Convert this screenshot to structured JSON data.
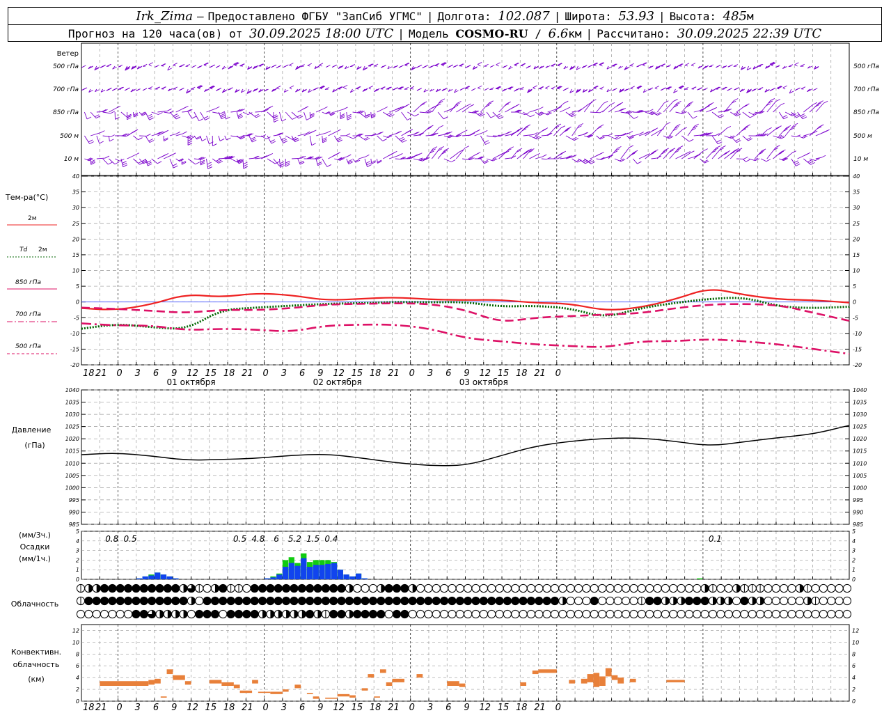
{
  "header": {
    "station": "Irk_Zima",
    "dash": "–",
    "provider": "Предоставлено ФГБУ \"ЗапСиб УГМС\"",
    "lon_label": "Долгота:",
    "lon_value": "102.087",
    "lat_label": "Широта:",
    "lat_value": "53.93",
    "alt_label": "Высота:",
    "alt_value": "485",
    "alt_unit": "м",
    "forecast_prefix": "Прогноз на 120 часа(ов) от",
    "forecast_time": "30.09.2025 18:00 UTC",
    "model_label": "Модель",
    "model_name": "COSMO-RU",
    "model_res": "6.6",
    "model_res_unit": "км",
    "calc_label": "Рассчитано:",
    "calc_time": "30.09.2025 22:39 UTC",
    "sep": "|"
  },
  "colors": {
    "t2m": "#ee2222",
    "td2m": "#006600",
    "t850": "#dd1166",
    "t700": "#dd1166",
    "t500": "#dd1166",
    "wind": "#7a00cc",
    "pressure": "#000000",
    "precip3h": "#11cc11",
    "precip1h": "#1144ee",
    "convective": "#e8803a",
    "grid": "#999999"
  },
  "chart_data": [
    {
      "type": "wind-barbs",
      "name": "wind",
      "title": "Ветер",
      "levels": [
        "500 гПа",
        "700 гПа",
        "850 гПа",
        "500 м",
        "10 м"
      ]
    },
    {
      "type": "line",
      "name": "temperature",
      "ylabel": "Тем-ра(°C)",
      "ylim": [
        -20,
        40
      ],
      "yticks": [
        -20,
        -15,
        -10,
        -5,
        0,
        5,
        10,
        15,
        20,
        25,
        30,
        35,
        40
      ],
      "x_hours": [
        0,
        6,
        12,
        18,
        24,
        30,
        36,
        42,
        48,
        54,
        60,
        66,
        72,
        78,
        84,
        90,
        96,
        102,
        108,
        114,
        120
      ],
      "series": [
        {
          "name": "2м",
          "key": "t2m",
          "style": "solid",
          "values": [
            -2.0,
            -2.6,
            -0.8,
            2.5,
            1.5,
            2.8,
            2.2,
            0.5,
            1.0,
            1.5,
            0.8,
            0.6,
            0.7,
            -0.3,
            -0.5,
            -2.8,
            -1.8,
            0.8,
            4.5,
            2.2,
            0.8,
            0.6,
            -0.2
          ]
        },
        {
          "name": "Td 2м",
          "key": "td2m",
          "style": "dot",
          "values": [
            -8.5,
            -7.0,
            -8.0,
            -8.8,
            -2.5,
            -1.8,
            -1.2,
            -0.6,
            -0.4,
            0.0,
            -0.1,
            0.0,
            -1.5,
            -1.2,
            -2.0,
            -5.0,
            -2.0,
            -0.3,
            1.0,
            1.5,
            -1.5,
            -2.0,
            -1.5
          ]
        },
        {
          "name": "850 гПа",
          "key": "t850",
          "style": "dash",
          "values": [
            -1.8,
            -2.2,
            -2.8,
            -3.5,
            -2.5,
            -2.6,
            -2.0,
            -0.8,
            -0.6,
            -0.4,
            -0.6,
            -2.5,
            -6.5,
            -5.0,
            -4.5,
            -4.0,
            -3.6,
            -2.0,
            -0.8,
            -0.6,
            -1.0,
            -3.5,
            -6.0
          ]
        },
        {
          "name": "700 гПа",
          "key": "t700",
          "style": "dashdot",
          "values": [
            -6.8,
            -7.5,
            -7.5,
            -9.0,
            -8.5,
            -8.8,
            -9.5,
            -7.5,
            -7.2,
            -7.2,
            -8.5,
            -11.5,
            -12.5,
            -13.5,
            -14.0,
            -14.5,
            -12.5,
            -12.5,
            -11.8,
            -12.5,
            -13.5,
            -15.0,
            -16.5
          ]
        }
      ],
      "legend": [
        "Тем-ра(°C)",
        "2м",
        "Td",
        "2м",
        "850 гПа",
        "700 гПа",
        "500 гПа"
      ]
    },
    {
      "type": "line",
      "name": "pressure",
      "ylabel": "Давление",
      "yunit": "(гПа)",
      "ylim": [
        985,
        1040
      ],
      "yticks": [
        985,
        990,
        995,
        1000,
        1005,
        1010,
        1015,
        1020,
        1025,
        1030,
        1035,
        1040
      ],
      "values": [
        1013.5,
        1014.2,
        1013.0,
        1011.2,
        1011.5,
        1012.0,
        1013.2,
        1013.8,
        1012.2,
        1010.2,
        1009.0,
        1009.0,
        1013.0,
        1017.0,
        1019.0,
        1020.2,
        1020.4,
        1019.0,
        1017.0,
        1018.8,
        1020.5,
        1022.0,
        1025.5
      ]
    },
    {
      "type": "bar",
      "name": "precipitation",
      "ylabel_3h": "(мм/3ч.)",
      "ylabel": "Осадки",
      "ylabel_1h": "(мм/1ч.)",
      "ylim": [
        0,
        5
      ],
      "yticks": [
        0,
        1,
        2,
        3,
        4,
        5
      ],
      "labels": [
        {
          "hour": 5,
          "text": "0.8"
        },
        {
          "hour": 8,
          "text": "0.5"
        },
        {
          "hour": 26,
          "text": "0.5"
        },
        {
          "hour": 29,
          "text": "4.8"
        },
        {
          "hour": 32,
          "text": "6"
        },
        {
          "hour": 35,
          "text": "5.2"
        },
        {
          "hour": 38,
          "text": "1.5"
        },
        {
          "hour": 41,
          "text": "0.4"
        },
        {
          "hour": 104,
          "text": "0.1"
        }
      ],
      "hours": [
        9,
        10,
        11,
        12,
        13,
        14,
        15,
        30,
        31,
        32,
        33,
        34,
        35,
        36,
        37,
        38,
        39,
        40,
        41,
        42,
        43,
        44,
        45,
        46,
        47,
        101
      ],
      "hourly": [
        0.1,
        0.3,
        0.4,
        0.7,
        0.5,
        0.3,
        0.1,
        0.1,
        0.2,
        0.5,
        1.3,
        1.7,
        1.4,
        2.2,
        1.3,
        1.5,
        1.5,
        1.6,
        1.7,
        1.0,
        0.5,
        0.3,
        0.6,
        0.1,
        0.0,
        0.0
      ],
      "threehour": [
        0.1,
        0.3,
        0.5,
        0.7,
        0.5,
        0.3,
        0.1,
        0.1,
        0.3,
        0.6,
        2.0,
        2.3,
        1.7,
        2.7,
        1.8,
        2.0,
        2.0,
        2.0,
        1.8,
        1.0,
        0.5,
        0.3,
        0.6,
        0.1,
        0.0,
        0.1
      ]
    },
    {
      "type": "table",
      "name": "cloudiness",
      "ylabel": "Облачность",
      "rows": [
        "12244444444442310241104444444444442000244420000000000000000000000000000000000002100211100002100000",
        "14444444444444204444444444444444444444444444444444444444444442000400000144222444222042200000210000",
        "00000004432222044404444222222421442444404400000000000000000000000000000000000000000000000000000000"
      ]
    },
    {
      "type": "bar",
      "name": "convective-cloudiness",
      "ylabel": "Конвективн.",
      "ylabel2": "облачность",
      "yunit": "(км)",
      "ylim": [
        0,
        13
      ],
      "yticks": [
        0,
        2,
        4,
        6,
        8,
        10,
        12
      ],
      "segments": [
        [
          3,
          11,
          2.6,
          3.4
        ],
        [
          11,
          12,
          2.8,
          3.6
        ],
        [
          12,
          13,
          3.0,
          3.8
        ],
        [
          13,
          14,
          0.6,
          0.8
        ],
        [
          14,
          15,
          4.6,
          5.4
        ],
        [
          15,
          17,
          3.6,
          4.4
        ],
        [
          17,
          18,
          2.8,
          3.4
        ],
        [
          21,
          23,
          3.0,
          3.6
        ],
        [
          23,
          25,
          2.6,
          3.2
        ],
        [
          25,
          26,
          2.2,
          2.8
        ],
        [
          26,
          28,
          1.4,
          1.8
        ],
        [
          28,
          29,
          3.0,
          3.6
        ],
        [
          29,
          31,
          1.4,
          1.6
        ],
        [
          31,
          33,
          1.2,
          1.6
        ],
        [
          33,
          34,
          1.6,
          2.0
        ],
        [
          35,
          36,
          2.2,
          2.8
        ],
        [
          37,
          38,
          1.2,
          1.4
        ],
        [
          38,
          39,
          0.4,
          0.8
        ],
        [
          40,
          42,
          0.4,
          0.6
        ],
        [
          42,
          44,
          0.8,
          1.2
        ],
        [
          44,
          45,
          0.6,
          1.0
        ],
        [
          46,
          47,
          1.8,
          2.2
        ],
        [
          47,
          48,
          4.0,
          4.6
        ],
        [
          48,
          49,
          0.6,
          0.8
        ],
        [
          49,
          50,
          4.8,
          5.4
        ],
        [
          50,
          51,
          2.6,
          3.2
        ],
        [
          51,
          53,
          3.2,
          3.8
        ],
        [
          55,
          56,
          4.0,
          4.6
        ],
        [
          60,
          62,
          2.6,
          3.4
        ],
        [
          62,
          63,
          2.4,
          3.0
        ],
        [
          72,
          73,
          2.6,
          3.2
        ],
        [
          74,
          75,
          4.6,
          5.2
        ],
        [
          75,
          78,
          4.8,
          5.4
        ],
        [
          80,
          81,
          3.0,
          3.6
        ],
        [
          82,
          83,
          3.0,
          3.8
        ],
        [
          83,
          84,
          3.2,
          4.6
        ],
        [
          84,
          85,
          2.4,
          4.8
        ],
        [
          85,
          86,
          2.6,
          4.2
        ],
        [
          86,
          87,
          4.2,
          5.6
        ],
        [
          87,
          88,
          3.6,
          4.4
        ],
        [
          88,
          89,
          3.0,
          4.0
        ],
        [
          90,
          91,
          3.2,
          3.8
        ],
        [
          96,
          99,
          3.2,
          3.6
        ]
      ]
    }
  ],
  "xaxis": {
    "ticks": [
      "18",
      "21",
      "0",
      "3",
      "6",
      "9",
      "12",
      "15",
      "18",
      "21",
      "0",
      "3",
      "6",
      "9",
      "12",
      "15",
      "18",
      "21",
      "0",
      "3",
      "6",
      "9",
      "12",
      "15",
      "18",
      "21",
      "0"
    ],
    "days": [
      "01 октября",
      "02 октября",
      "03 октября"
    ]
  }
}
